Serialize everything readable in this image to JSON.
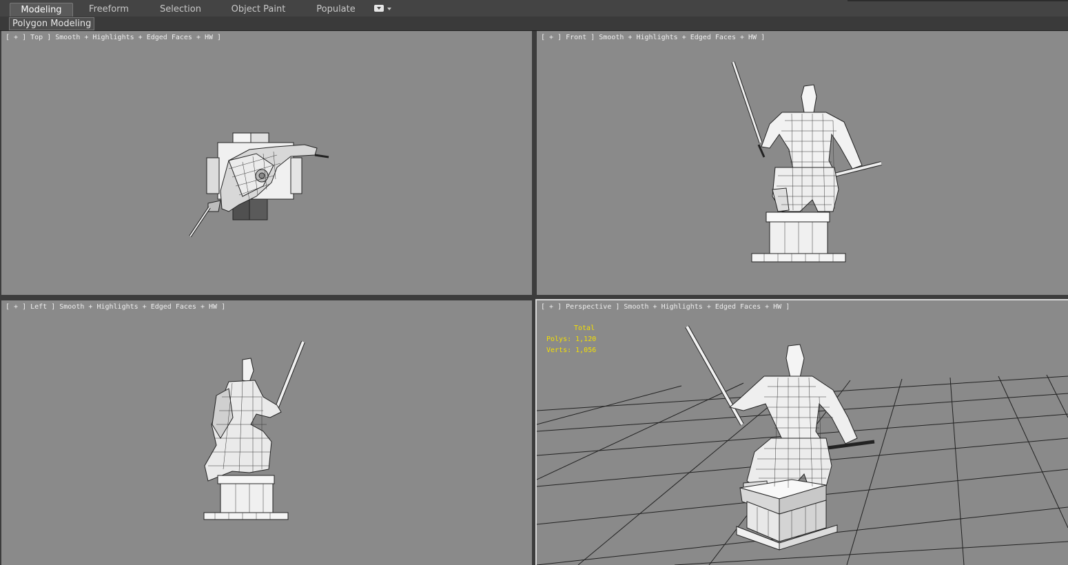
{
  "ribbon": {
    "tabs": [
      {
        "label": "Modeling",
        "active": true
      },
      {
        "label": "Freeform",
        "active": false
      },
      {
        "label": "Selection",
        "active": false
      },
      {
        "label": "Object Paint",
        "active": false
      },
      {
        "label": "Populate",
        "active": false
      }
    ],
    "options_icon": "ribbon-options-icon"
  },
  "subpanel": {
    "label": "Polygon Modeling"
  },
  "viewports": {
    "top": {
      "label": "[ + ] Top ] Smooth + Highlights + Edged Faces + HW ]"
    },
    "front": {
      "label": "[ + ] Front ] Smooth + Highlights + Edged Faces + HW ]"
    },
    "left": {
      "label": "[ + ] Left ] Smooth + Highlights + Edged Faces + HW ]"
    },
    "perspective": {
      "label": "[ + ] Perspective ] Smooth + Highlights + Edged Faces + HW ]"
    }
  },
  "stats": {
    "total": "Total",
    "polys": "Polys: 1,120",
    "verts": "Verts: 1,056"
  },
  "colors": {
    "viewport_bg": "#8a8a8a",
    "stats_text": "#f5e000",
    "ui_bg": "#444444"
  }
}
